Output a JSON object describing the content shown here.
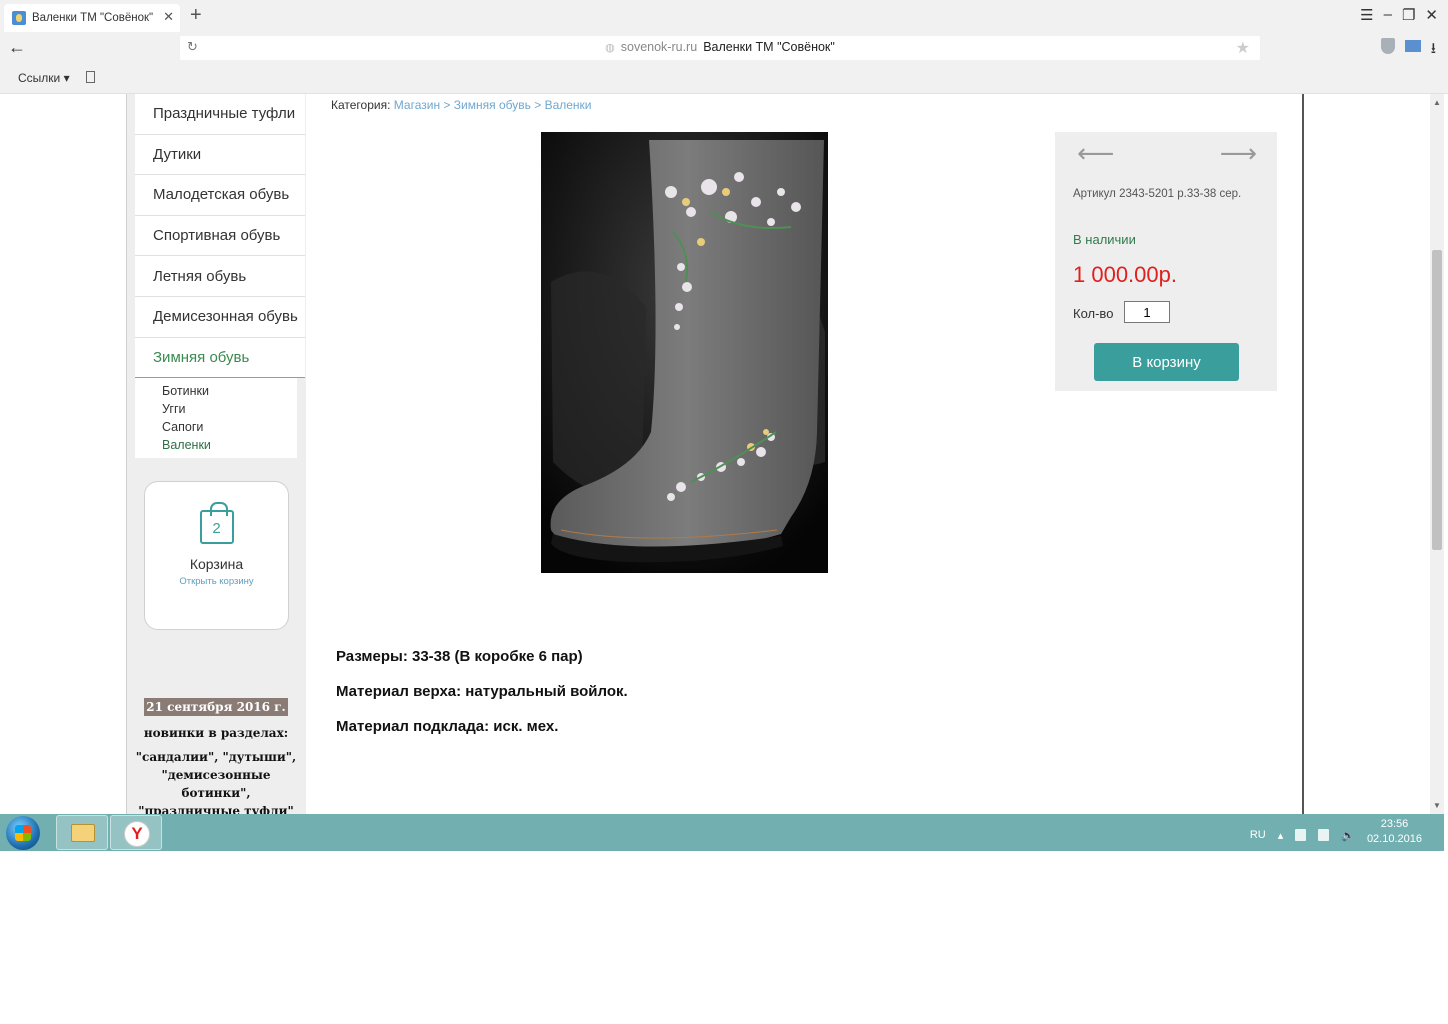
{
  "browser": {
    "tab_title": "Валенки ТМ \"Совёнок\"",
    "tab_close": "✕",
    "new_tab": "+",
    "url_domain": "sovenok-ru.ru",
    "url_title": "Валенки ТМ \"Совёнок\"",
    "bookmarks_label": "Ссылки ▾"
  },
  "sidebar": {
    "menu": [
      {
        "label": "Праздничные туфли"
      },
      {
        "label": "Дутики"
      },
      {
        "label": "Малодетская обувь"
      },
      {
        "label": "Спортивная обувь"
      },
      {
        "label": "Летняя обувь"
      },
      {
        "label": "Демисезонная обувь"
      },
      {
        "label": "Зимняя обувь"
      }
    ],
    "submenu": [
      {
        "label": "Ботинки"
      },
      {
        "label": "Угги"
      },
      {
        "label": "Сапоги"
      },
      {
        "label": "Валенки"
      }
    ],
    "cart": {
      "count": "2",
      "title": "Корзина",
      "link": "Открыть корзину"
    },
    "news": {
      "date": "21 сентября 2016 г.",
      "line1": "новинки в разделах:",
      "line2": "\"сандалии\", \"дутыши\", \"демисезонные ботинки\",",
      "line3": "\"праздничные туфли\""
    }
  },
  "breadcrumb": {
    "label": "Категория:",
    "shop": "Магазин",
    "sep1": ">",
    "category": "Зимняя обувь",
    "sep2": ">",
    "current": "Валенки"
  },
  "product": {
    "sku": "Артикул 2343-5201 р.33-38 сер.",
    "stock": "В наличии",
    "price": "1 000.00р.",
    "qty_label": "Кол-во",
    "qty_value": "1",
    "add_to_cart": "В корзину",
    "description": [
      "Размеры: 33-38 (В коробке 6 пар)",
      "Материал верха: натуральный войлок.",
      "Материал подклада: иск. мех."
    ]
  },
  "taskbar": {
    "lang": "RU",
    "time": "23:56",
    "date": "02.10.2016"
  }
}
